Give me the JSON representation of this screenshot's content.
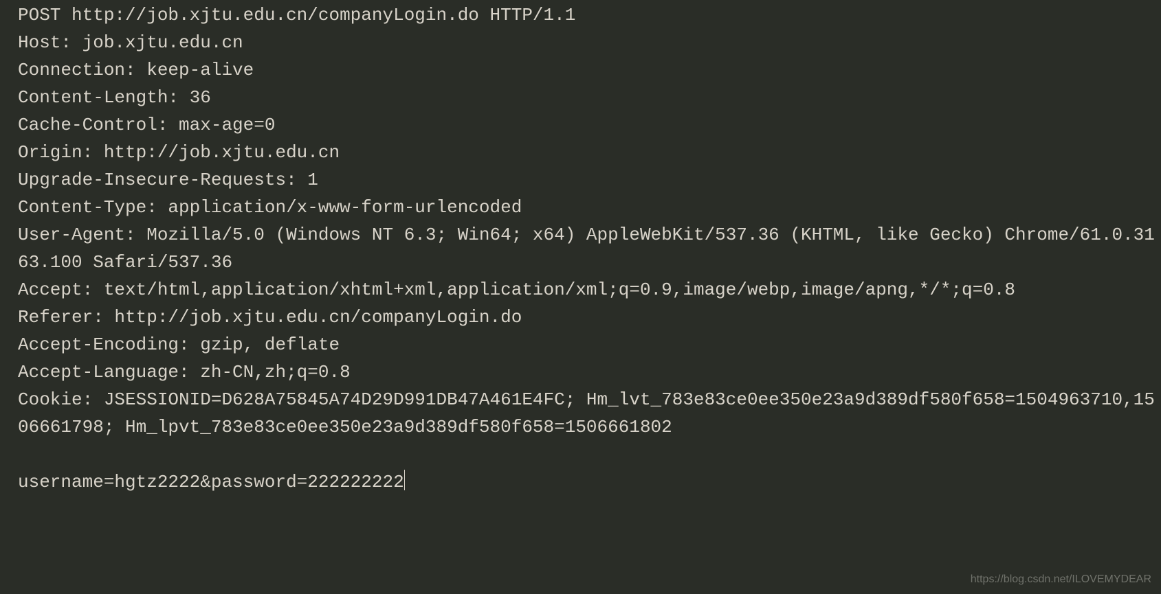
{
  "lines": [
    "POST http://job.xjtu.edu.cn/companyLogin.do HTTP/1.1",
    "Host: job.xjtu.edu.cn",
    "Connection: keep-alive",
    "Content-Length: 36",
    "Cache-Control: max-age=0",
    "Origin: http://job.xjtu.edu.cn",
    "Upgrade-Insecure-Requests: 1",
    "Content-Type: application/x-www-form-urlencoded",
    "User-Agent: Mozilla/5.0 (Windows NT 6.3; Win64; x64) AppleWebKit/537.36 (KHTML, like Gecko) Chrome/61.0.3163.100 Safari/537.36",
    "Accept: text/html,application/xhtml+xml,application/xml;q=0.9,image/webp,image/apng,*/*;q=0.8",
    "Referer: http://job.xjtu.edu.cn/companyLogin.do",
    "Accept-Encoding: gzip, deflate",
    "Accept-Language: zh-CN,zh;q=0.8",
    "Cookie: JSESSIONID=D628A75845A74D29D991DB47A461E4FC; Hm_lvt_783e83ce0ee350e23a9d389df580f658=1504963710,1506661798; Hm_lpvt_783e83ce0ee350e23a9d389df580f658=1506661802",
    "",
    "username=hgtz2222&password=222222222"
  ],
  "watermark": "https://blog.csdn.net/ILOVEMYDEAR"
}
